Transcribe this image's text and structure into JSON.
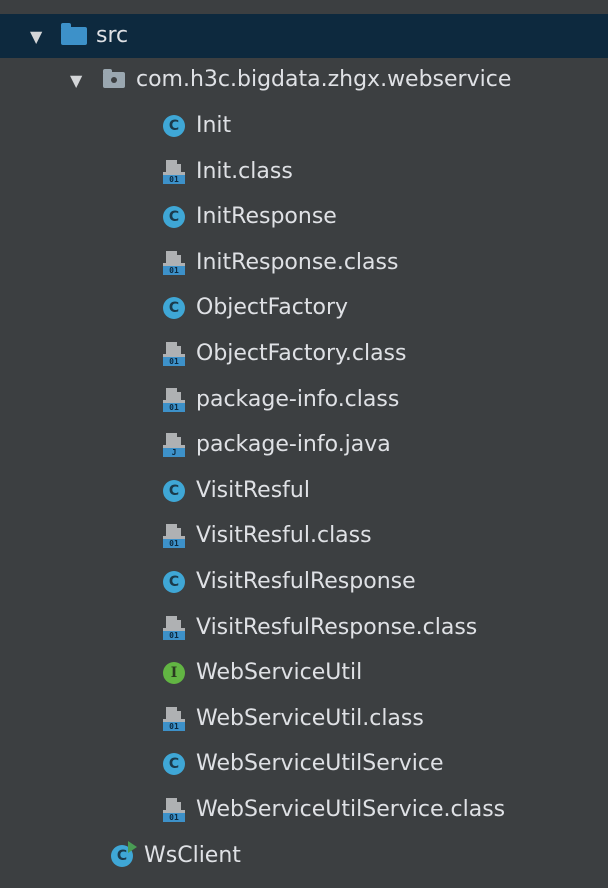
{
  "tree": {
    "src": {
      "label": "src",
      "expanded": true,
      "icon": "folder-icon"
    },
    "package": {
      "label": "com.h3c.bigdata.zhgx.webservice",
      "expanded": true,
      "icon": "package-icon"
    },
    "items": [
      {
        "label": "Init",
        "type": "class-icon",
        "glyph": "C"
      },
      {
        "label": "Init.class",
        "type": "binary-file-icon",
        "glyph": "01"
      },
      {
        "label": "InitResponse",
        "type": "class-icon",
        "glyph": "C"
      },
      {
        "label": "InitResponse.class",
        "type": "binary-file-icon",
        "glyph": "01"
      },
      {
        "label": "ObjectFactory",
        "type": "class-icon",
        "glyph": "C"
      },
      {
        "label": "ObjectFactory.class",
        "type": "binary-file-icon",
        "glyph": "01"
      },
      {
        "label": "package-info.class",
        "type": "binary-file-icon",
        "glyph": "01"
      },
      {
        "label": "package-info.java",
        "type": "java-file-icon",
        "glyph": "J"
      },
      {
        "label": "VisitResful",
        "type": "class-icon",
        "glyph": "C"
      },
      {
        "label": "VisitResful.class",
        "type": "binary-file-icon",
        "glyph": "01"
      },
      {
        "label": "VisitResfulResponse",
        "type": "class-icon",
        "glyph": "C"
      },
      {
        "label": "VisitResfulResponse.class",
        "type": "binary-file-icon",
        "glyph": "01"
      },
      {
        "label": "WebServiceUtil",
        "type": "interface-icon",
        "glyph": "I"
      },
      {
        "label": "WebServiceUtil.class",
        "type": "binary-file-icon",
        "glyph": "01"
      },
      {
        "label": "WebServiceUtilService",
        "type": "class-icon",
        "glyph": "C"
      },
      {
        "label": "WebServiceUtilService.class",
        "type": "binary-file-icon",
        "glyph": "01"
      }
    ],
    "wsclient": {
      "label": "WsClient",
      "type": "runnable-class-icon",
      "glyph": "C"
    }
  },
  "colors": {
    "background": "#3c3f41",
    "selected_row": "#0d293e",
    "folder": "#3d91c9",
    "class_icon": "#3fa7d6",
    "interface_icon": "#62b543",
    "text": "#dfe1e5"
  }
}
